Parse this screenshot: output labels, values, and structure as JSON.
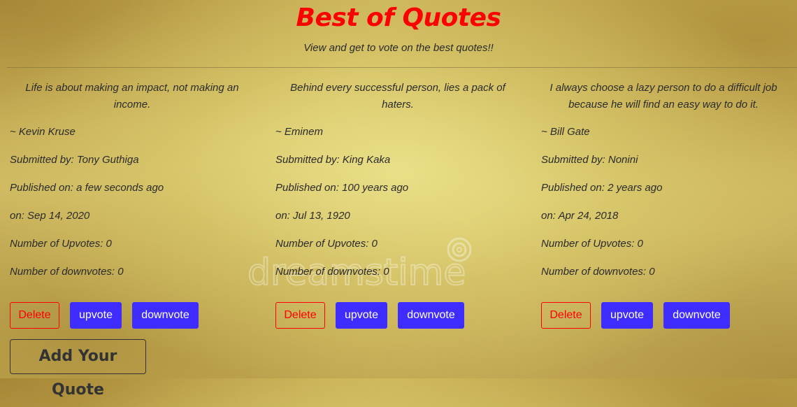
{
  "header": {
    "title": "Best of Quotes",
    "subtitle": "View and get to vote on the best quotes!!"
  },
  "quotes": [
    {
      "text": "Life is about making an impact, not making an income.",
      "author": "~ Kevin Kruse",
      "submitted": "Submitted by: Tony Guthiga",
      "published": "Published on: a few seconds ago",
      "date": "on: Sep 14, 2020",
      "upvotes": "Number of Upvotes: 0",
      "downvotes": "Number of downvotes: 0",
      "delete_label": "Delete",
      "upvote_label": "upvote",
      "downvote_label": "downvote"
    },
    {
      "text": "Behind every successful person, lies a pack of haters.",
      "author": "~ Eminem",
      "submitted": "Submitted by: King Kaka",
      "published": "Published on: 100 years ago",
      "date": "on: Jul 13, 1920",
      "upvotes": "Number of Upvotes: 0",
      "downvotes": "Number of downvotes: 0",
      "delete_label": "Delete",
      "upvote_label": "upvote",
      "downvote_label": "downvote"
    },
    {
      "text": "I always choose a lazy person to do a difficult job because he will find an easy way to do it.",
      "author": "~ Bill Gate",
      "submitted": "Submitted by: Nonini",
      "published": "Published on: 2 years ago",
      "date": "on: Apr 24, 2018",
      "upvotes": "Number of Upvotes: 0",
      "downvotes": "Number of downvotes: 0",
      "delete_label": "Delete",
      "upvote_label": "upvote",
      "downvote_label": "downvote"
    }
  ],
  "add_quote_label": "Add Your Quote",
  "watermark_text": "dreamstime",
  "colors": {
    "title": "#ff0000",
    "delete": "#ff0000",
    "vote_button": "#3f2cff",
    "text": "#2b2b2b"
  }
}
